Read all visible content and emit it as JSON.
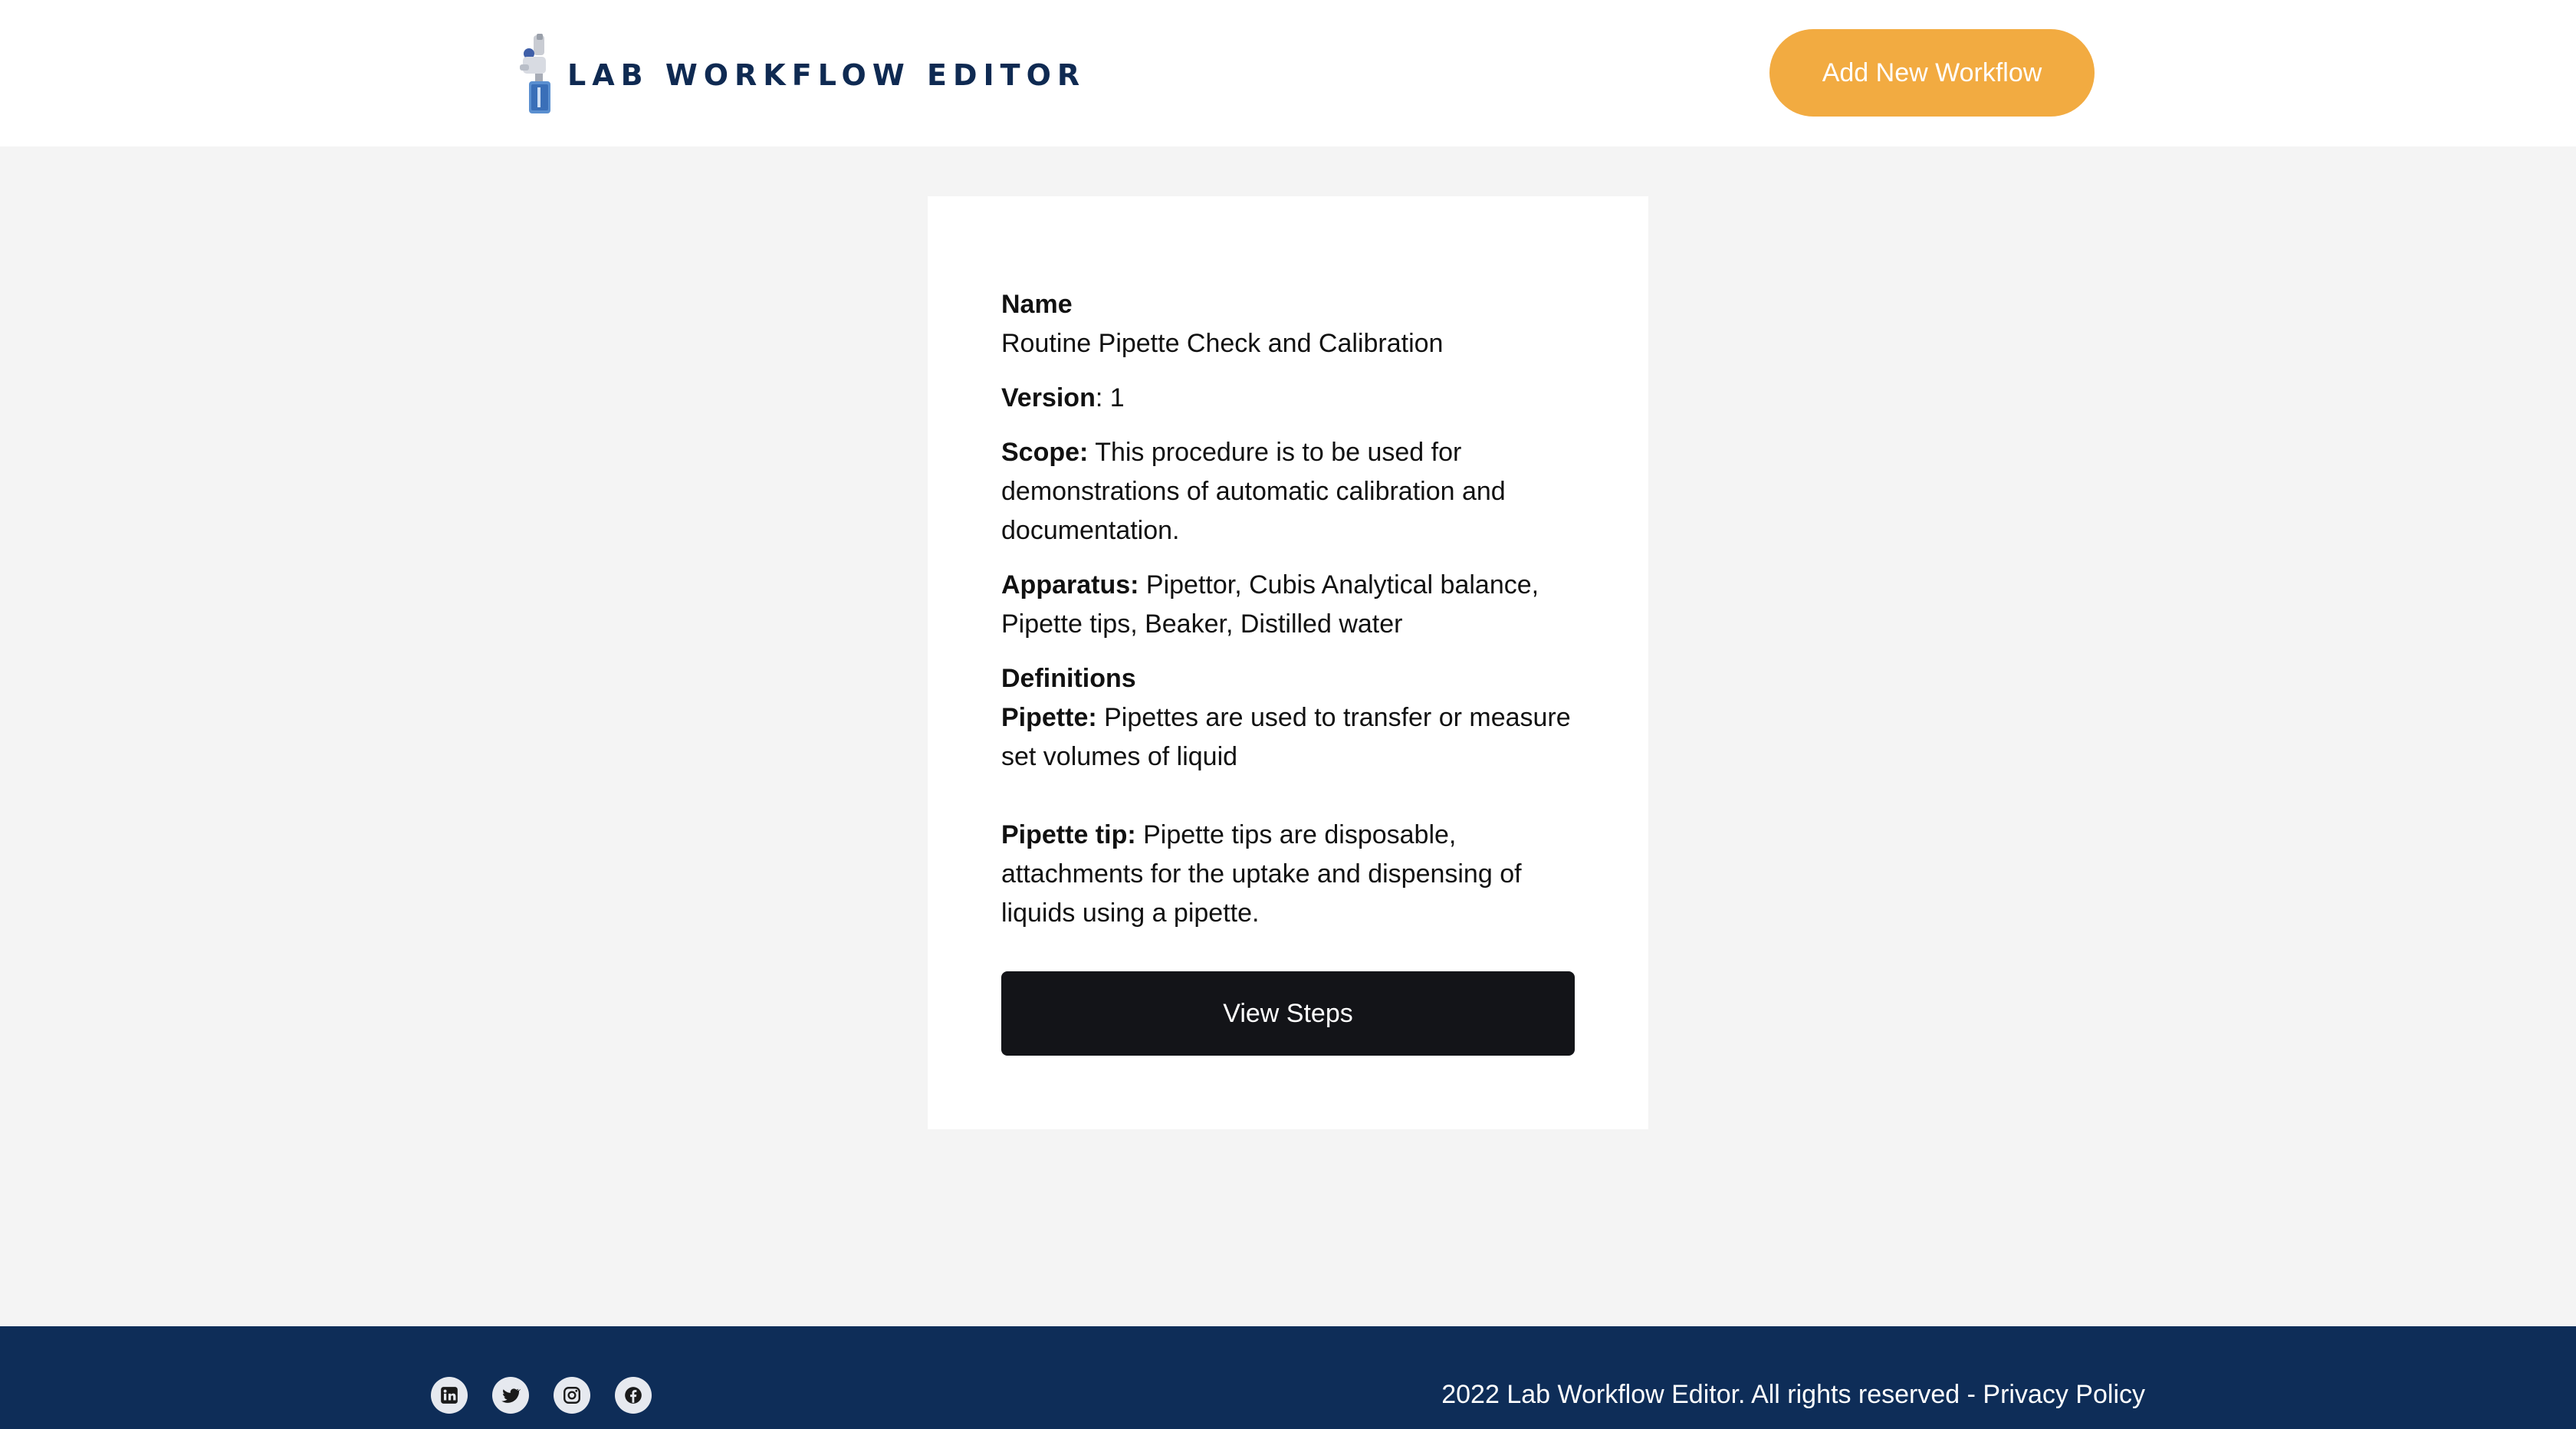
{
  "header": {
    "logo_text": "LAB WORKFLOW EDITOR",
    "add_button_label": "Add New Workflow"
  },
  "workflow": {
    "name_label": "Name",
    "name_value": "Routine Pipette Check and Calibration",
    "version_label": "Version",
    "version_value": ": 1",
    "scope_label": "Scope:",
    "scope_value": " This procedure is to be used for demonstrations of automatic calibration and documentation.",
    "apparatus_label": "Apparatus:",
    "apparatus_value": " Pipettor, Cubis Analytical balance, Pipette tips, Beaker, Distilled water",
    "definitions_label": "Definitions",
    "definitions": [
      {
        "term": "Pipette:",
        "text": " Pipettes are used to transfer or measure set volumes of liquid"
      },
      {
        "term": "Pipette tip:",
        "text": " Pipette tips are disposable, attachments for the uptake and dispensing of liquids using a pipette."
      }
    ],
    "view_steps_label": "View Steps"
  },
  "footer": {
    "social_icons": [
      "linkedin-icon",
      "twitter-icon",
      "instagram-icon",
      "facebook-icon"
    ],
    "copyright": "2022 Lab Workflow Editor. All rights reserved - ",
    "privacy_label": "Privacy Policy"
  },
  "colors": {
    "brand_navy": "#0f2a52",
    "accent_orange": "#f2ab41",
    "footer_bg": "#0e2d58",
    "button_dark": "#131418",
    "page_bg": "#f4f4f4"
  }
}
